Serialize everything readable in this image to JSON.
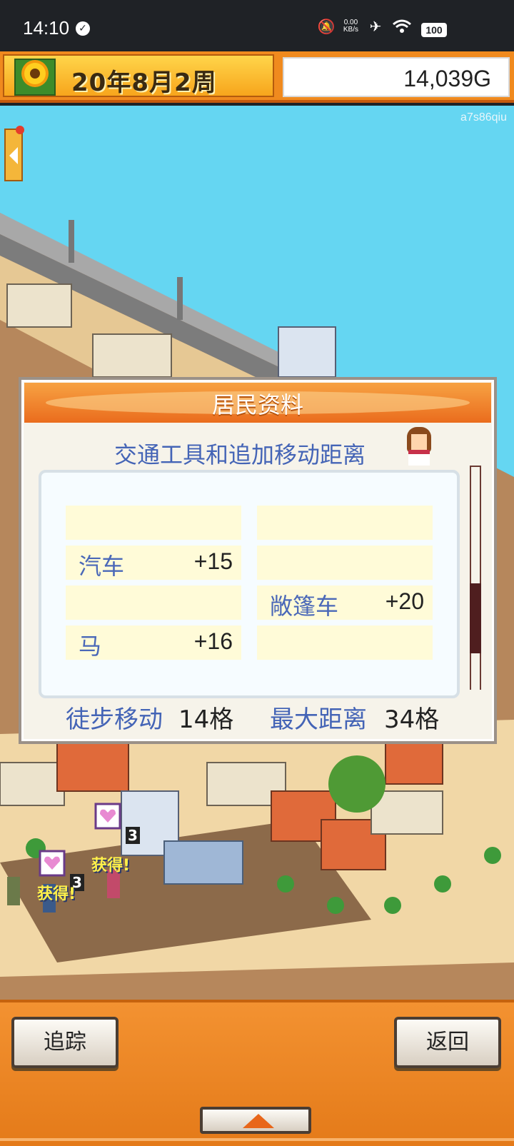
{
  "status_bar": {
    "time": "14:10",
    "net_speed_value": "0.00",
    "net_speed_unit": "KB/s",
    "battery": "100",
    "icons": [
      "check-circle-icon",
      "mute-bell-icon",
      "airplane-icon",
      "wifi-icon",
      "battery-icon"
    ]
  },
  "top_bar": {
    "date": "20年8月2周",
    "money": "14,039G"
  },
  "map": {
    "user_tag": "a7s86qiu",
    "bubbles": [
      {
        "label": "获得!",
        "count": "3"
      },
      {
        "label": "获得!",
        "count": "3"
      }
    ]
  },
  "dialog": {
    "title": "居民资料",
    "subtitle": "交通工具和追加移动距离",
    "cells": [
      {
        "label": "",
        "value": ""
      },
      {
        "label": "",
        "value": ""
      },
      {
        "label": "汽车",
        "value": "+15"
      },
      {
        "label": "",
        "value": ""
      },
      {
        "label": "",
        "value": ""
      },
      {
        "label": "敞篷车",
        "value": "+20"
      },
      {
        "label": "马",
        "value": "+16"
      },
      {
        "label": "",
        "value": ""
      }
    ],
    "walk_label": "徒步移动",
    "walk_value": "14格",
    "max_label": "最大距离",
    "max_value": "34格",
    "scroll_position": 0.75
  },
  "bottom": {
    "track_button": "追踪",
    "back_button": "返回"
  },
  "colors": {
    "accent_orange": "#f08a1e",
    "sky": "#65d6f2",
    "label_blue": "#4464b6"
  }
}
